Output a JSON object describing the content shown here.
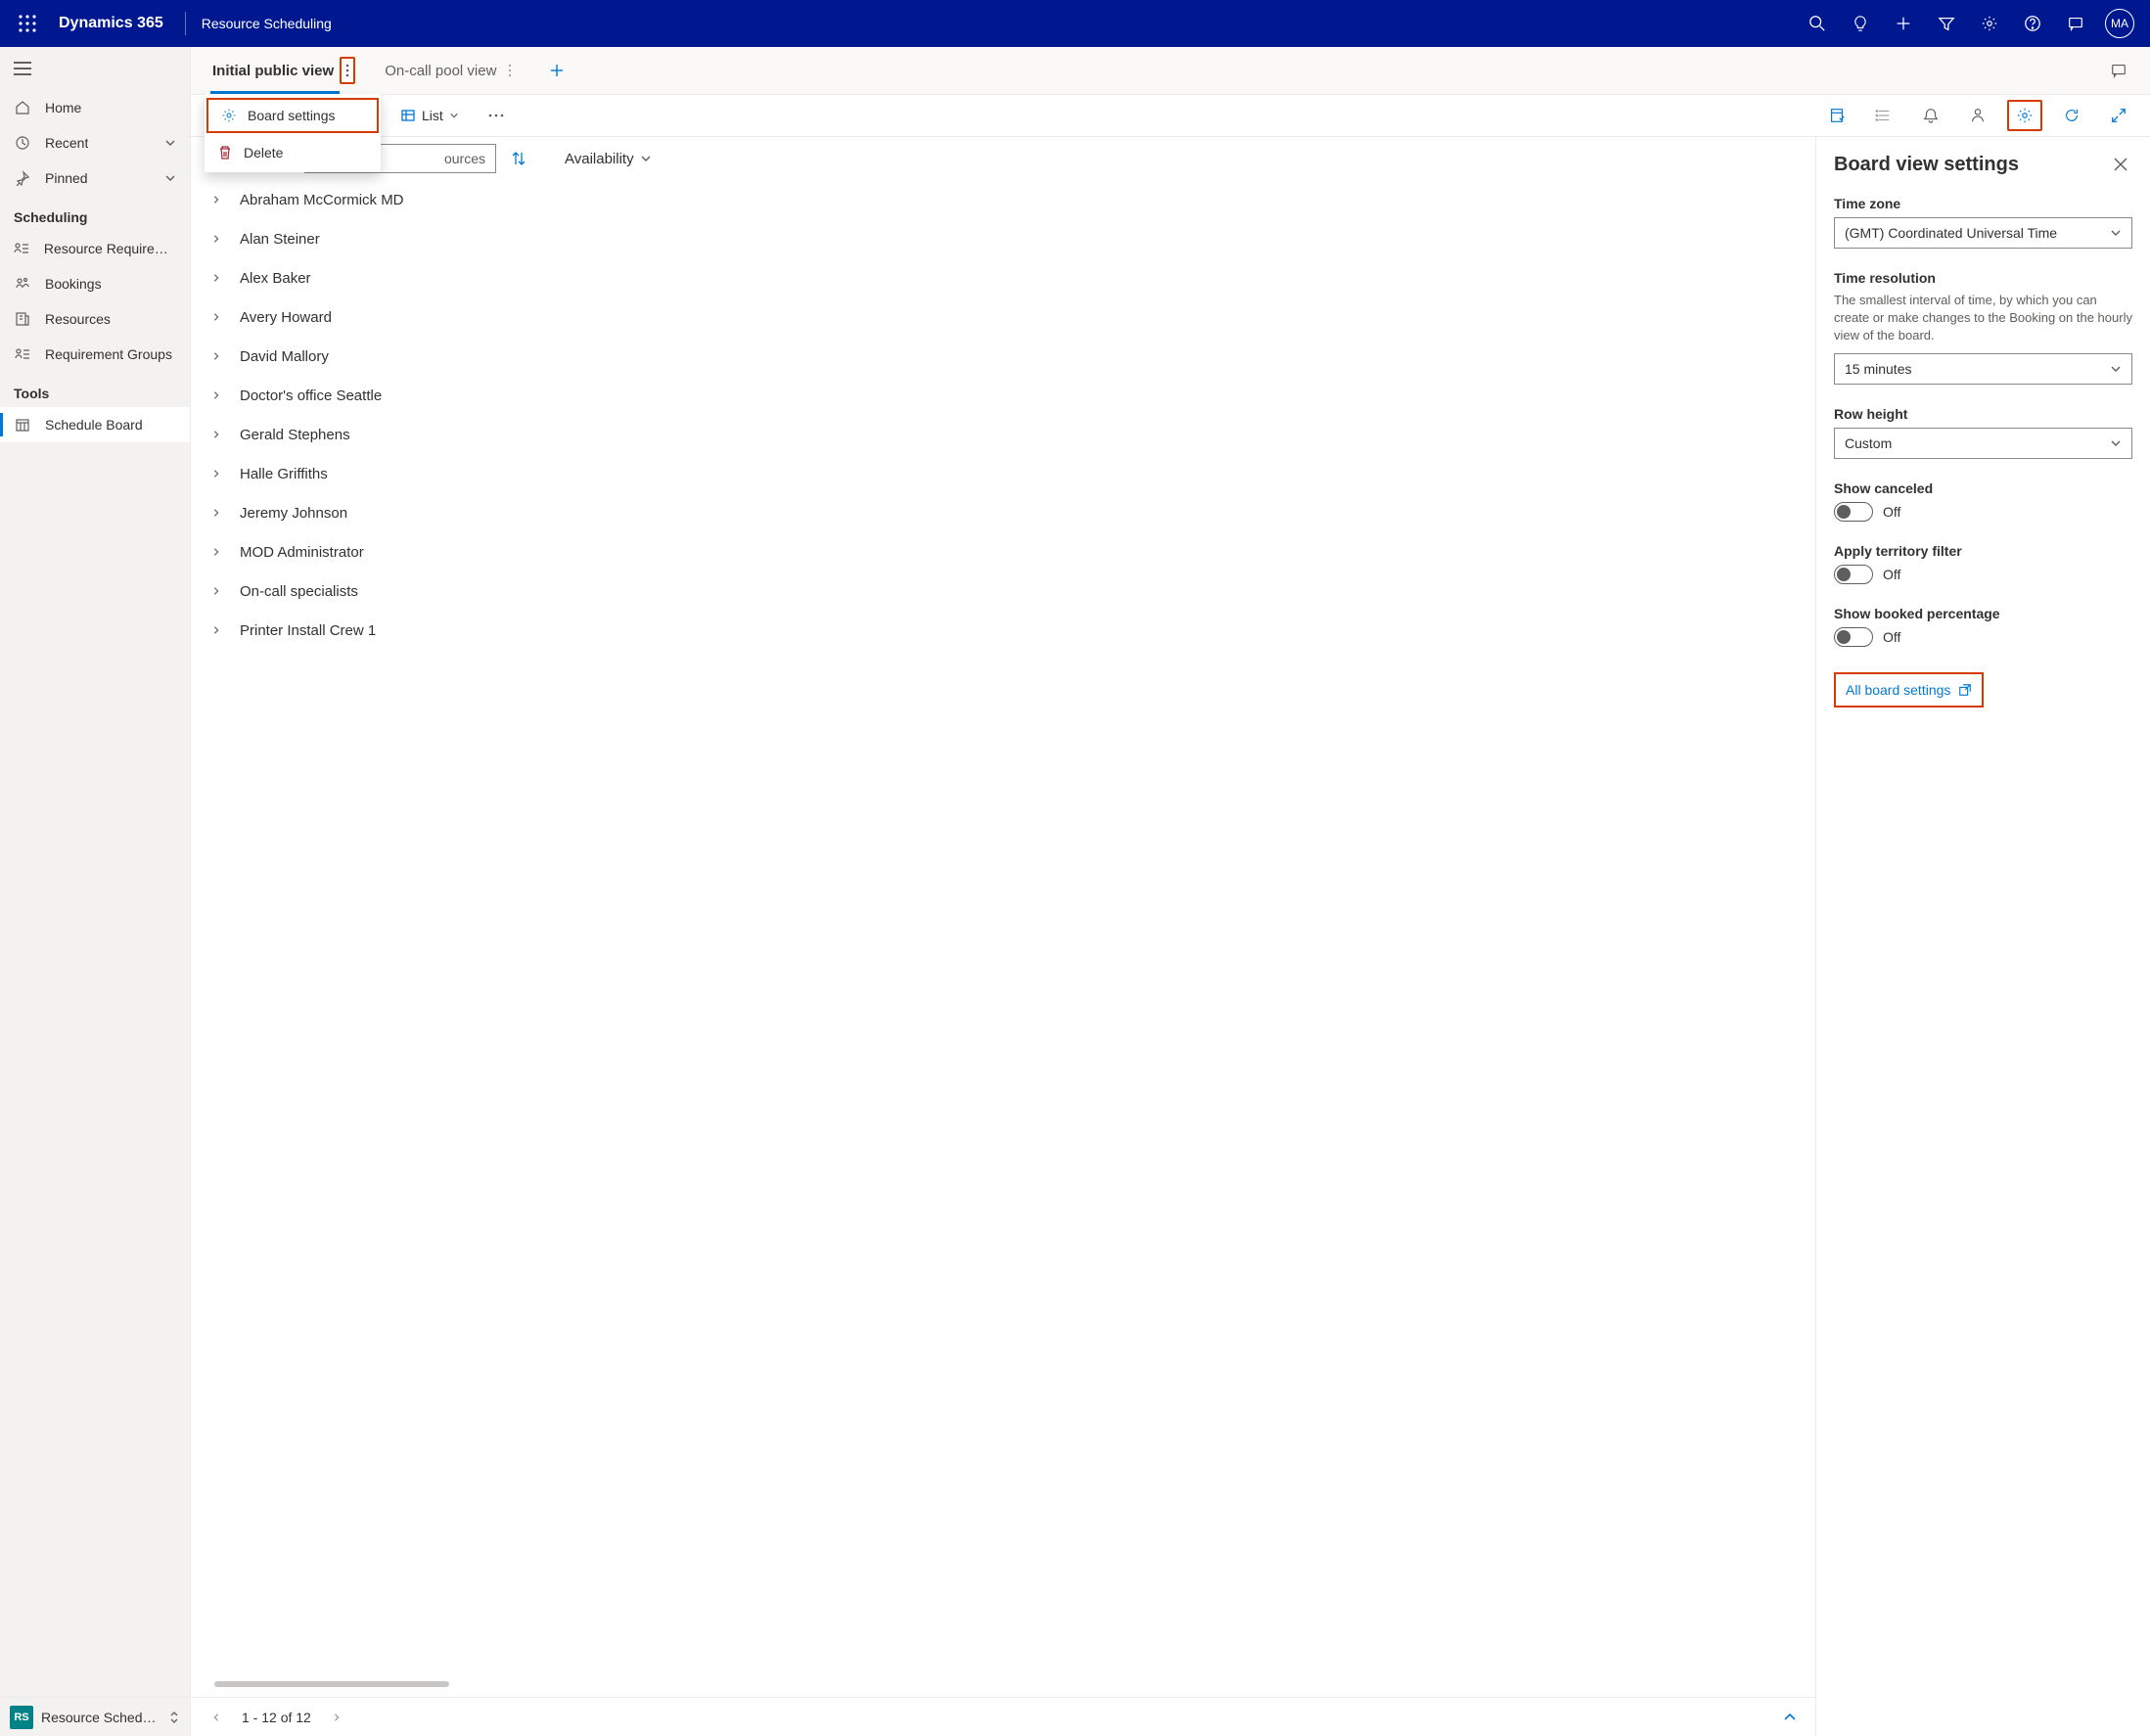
{
  "header": {
    "app_title": "Dynamics 365",
    "module_name": "Resource Scheduling",
    "avatar_initials": "MA"
  },
  "left_nav": {
    "home": "Home",
    "recent": "Recent",
    "pinned": "Pinned",
    "section_scheduling": "Scheduling",
    "scheduling_items": [
      "Resource Requireme...",
      "Bookings",
      "Resources",
      "Requirement Groups"
    ],
    "section_tools": "Tools",
    "tools_items": [
      "Schedule Board"
    ],
    "footer_badge": "RS",
    "footer_label": "Resource Schedul..."
  },
  "tabs": {
    "active": "Initial public view",
    "other": "On-call pool view"
  },
  "context_menu": {
    "board_settings": "Board settings",
    "delete": "Delete"
  },
  "toolbar": {
    "list_label": "List"
  },
  "filter_bar": {
    "search_placeholder": "ources",
    "sort_label": "Availability"
  },
  "resources": [
    "Abraham McCormick MD",
    "Alan Steiner",
    "Alex Baker",
    "Avery Howard",
    "David Mallory",
    "Doctor's office Seattle",
    "Gerald Stephens",
    "Halle Griffiths",
    "Jeremy Johnson",
    "MOD Administrator",
    "On-call specialists",
    "Printer Install Crew 1"
  ],
  "settings": {
    "title": "Board view settings",
    "timezone_label": "Time zone",
    "timezone_value": "(GMT) Coordinated Universal Time",
    "resolution_label": "Time resolution",
    "resolution_desc": "The smallest interval of time, by which you can create or make changes to the Booking on the hourly view of the board.",
    "resolution_value": "15 minutes",
    "rowheight_label": "Row height",
    "rowheight_value": "Custom",
    "canceled_label": "Show canceled",
    "canceled_value": "Off",
    "territory_label": "Apply territory filter",
    "territory_value": "Off",
    "booked_label": "Show booked percentage",
    "booked_value": "Off",
    "all_settings": "All board settings"
  },
  "pager": {
    "text": "1 - 12 of 12"
  }
}
